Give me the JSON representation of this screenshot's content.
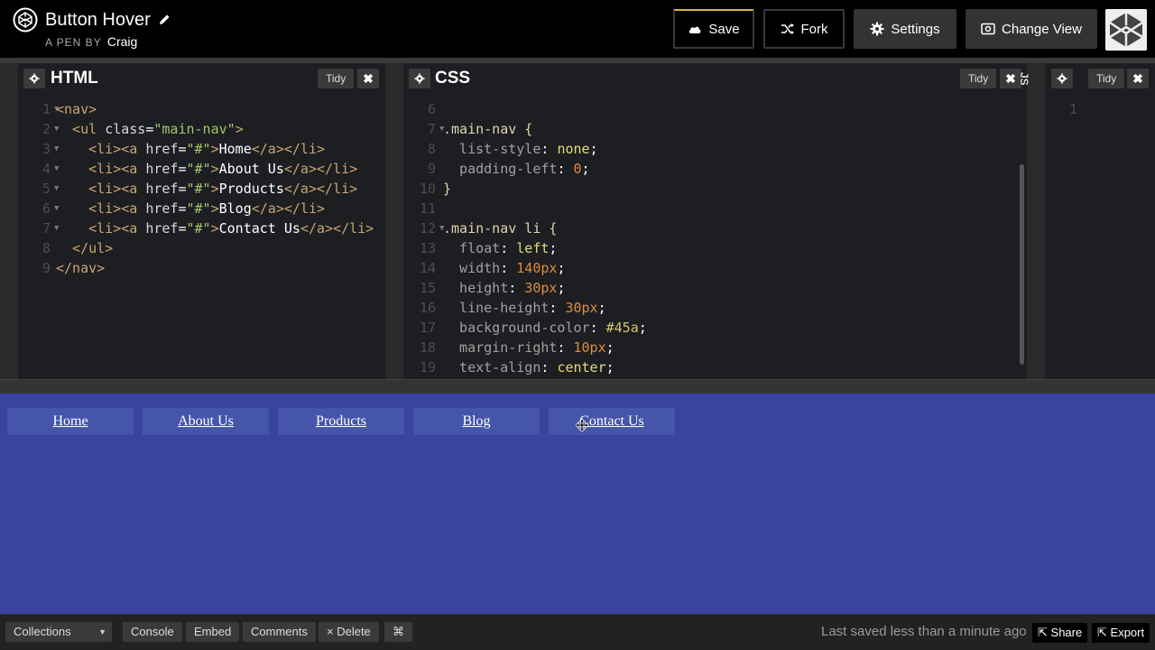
{
  "header": {
    "pen_title": "Button Hover",
    "byline_prefix": "A PEN BY",
    "author": "Craig",
    "buttons": {
      "save": "Save",
      "fork": "Fork",
      "settings": "Settings",
      "change_view": "Change View"
    }
  },
  "editors": {
    "html": {
      "title": "HTML",
      "tidy": "Tidy",
      "close": "✖",
      "lines": [
        {
          "n": "1",
          "fold": true,
          "parts": [
            [
              "<nav>",
              "t-tag"
            ]
          ]
        },
        {
          "n": "2",
          "fold": true,
          "parts": [
            [
              "  <ul ",
              "t-tag"
            ],
            [
              "class",
              "t-attr"
            ],
            [
              "=",
              "t-plain"
            ],
            [
              "\"main-nav\"",
              "t-str"
            ],
            [
              ">",
              "t-tag"
            ]
          ]
        },
        {
          "n": "3",
          "fold": true,
          "parts": [
            [
              "    <li><a ",
              "t-tag"
            ],
            [
              "href",
              "t-attr"
            ],
            [
              "=",
              "t-plain"
            ],
            [
              "\"#\"",
              "t-str"
            ],
            [
              ">",
              "t-tag"
            ],
            [
              "Home",
              "t-plain"
            ],
            [
              "</a></li>",
              "t-tag"
            ]
          ]
        },
        {
          "n": "4",
          "fold": true,
          "parts": [
            [
              "    <li><a ",
              "t-tag"
            ],
            [
              "href",
              "t-attr"
            ],
            [
              "=",
              "t-plain"
            ],
            [
              "\"#\"",
              "t-str"
            ],
            [
              ">",
              "t-tag"
            ],
            [
              "About Us",
              "t-plain"
            ],
            [
              "</a></li>",
              "t-tag"
            ]
          ]
        },
        {
          "n": "5",
          "fold": true,
          "parts": [
            [
              "    <li><a ",
              "t-tag"
            ],
            [
              "href",
              "t-attr"
            ],
            [
              "=",
              "t-plain"
            ],
            [
              "\"#\"",
              "t-str"
            ],
            [
              ">",
              "t-tag"
            ],
            [
              "Products",
              "t-plain"
            ],
            [
              "</a></li>",
              "t-tag"
            ]
          ]
        },
        {
          "n": "6",
          "fold": true,
          "parts": [
            [
              "    <li><a ",
              "t-tag"
            ],
            [
              "href",
              "t-attr"
            ],
            [
              "=",
              "t-plain"
            ],
            [
              "\"#\"",
              "t-str"
            ],
            [
              ">",
              "t-tag"
            ],
            [
              "Blog",
              "t-plain"
            ],
            [
              "</a></li>",
              "t-tag"
            ]
          ]
        },
        {
          "n": "7",
          "fold": true,
          "parts": [
            [
              "    <li><a ",
              "t-tag"
            ],
            [
              "href",
              "t-attr"
            ],
            [
              "=",
              "t-plain"
            ],
            [
              "\"#\"",
              "t-str"
            ],
            [
              ">",
              "t-tag"
            ],
            [
              "Contact Us",
              "t-plain"
            ],
            [
              "</a></li>",
              "t-tag"
            ]
          ]
        },
        {
          "n": "8",
          "fold": false,
          "parts": [
            [
              "  </ul>",
              "t-tag"
            ]
          ]
        },
        {
          "n": "9",
          "fold": false,
          "parts": [
            [
              "</nav>",
              "t-tag"
            ]
          ]
        }
      ]
    },
    "css": {
      "title": "CSS",
      "tidy": "Tidy",
      "close": "✖",
      "lines": [
        {
          "n": "6",
          "fold": false,
          "parts": []
        },
        {
          "n": "7",
          "fold": true,
          "parts": [
            [
              ".main-nav {",
              "t-sel"
            ]
          ]
        },
        {
          "n": "8",
          "fold": false,
          "parts": [
            [
              "  list-style",
              "t-prop"
            ],
            [
              ": ",
              "t-plain"
            ],
            [
              "none",
              "t-val"
            ],
            [
              ";",
              "t-plain"
            ]
          ]
        },
        {
          "n": "9",
          "fold": false,
          "parts": [
            [
              "  padding-left",
              "t-prop"
            ],
            [
              ": ",
              "t-plain"
            ],
            [
              "0",
              "t-num"
            ],
            [
              ";",
              "t-plain"
            ]
          ]
        },
        {
          "n": "10",
          "fold": false,
          "parts": [
            [
              "}",
              "t-sel"
            ]
          ]
        },
        {
          "n": "11",
          "fold": false,
          "parts": []
        },
        {
          "n": "12",
          "fold": true,
          "parts": [
            [
              ".main-nav li {",
              "t-sel"
            ]
          ]
        },
        {
          "n": "13",
          "fold": false,
          "parts": [
            [
              "  float",
              "t-prop"
            ],
            [
              ": ",
              "t-plain"
            ],
            [
              "left",
              "t-val"
            ],
            [
              ";",
              "t-plain"
            ]
          ]
        },
        {
          "n": "14",
          "fold": false,
          "parts": [
            [
              "  width",
              "t-prop"
            ],
            [
              ": ",
              "t-plain"
            ],
            [
              "140px",
              "t-num"
            ],
            [
              ";",
              "t-plain"
            ]
          ]
        },
        {
          "n": "15",
          "fold": false,
          "parts": [
            [
              "  height",
              "t-prop"
            ],
            [
              ": ",
              "t-plain"
            ],
            [
              "30px",
              "t-num"
            ],
            [
              ";",
              "t-plain"
            ]
          ]
        },
        {
          "n": "16",
          "fold": false,
          "parts": [
            [
              "  line-height",
              "t-prop"
            ],
            [
              ": ",
              "t-plain"
            ],
            [
              "30px",
              "t-num"
            ],
            [
              ";",
              "t-plain"
            ]
          ]
        },
        {
          "n": "17",
          "fold": false,
          "parts": [
            [
              "  background-color",
              "t-prop"
            ],
            [
              ": ",
              "t-plain"
            ],
            [
              "#45a",
              "t-col"
            ],
            [
              ";",
              "t-plain"
            ]
          ]
        },
        {
          "n": "18",
          "fold": false,
          "parts": [
            [
              "  margin-right",
              "t-prop"
            ],
            [
              ": ",
              "t-plain"
            ],
            [
              "10px",
              "t-num"
            ],
            [
              ";",
              "t-plain"
            ]
          ]
        },
        {
          "n": "19",
          "fold": false,
          "parts": [
            [
              "  text-align",
              "t-prop"
            ],
            [
              ": ",
              "t-plain"
            ],
            [
              "center",
              "t-val"
            ],
            [
              ";",
              "t-plain"
            ]
          ]
        }
      ]
    },
    "js": {
      "title": "JS",
      "tidy": "Tidy",
      "close": "✖",
      "lines": [
        {
          "n": "1",
          "fold": false,
          "parts": []
        }
      ]
    }
  },
  "preview": {
    "nav_items": [
      "Home",
      "About Us",
      "Products",
      "Blog",
      "Contact Us"
    ]
  },
  "footer": {
    "collections": "Collections",
    "console": "Console",
    "embed": "Embed",
    "comments": "Comments",
    "delete": "× Delete",
    "shortcut": "⌘",
    "last_saved": "Last saved less than a minute ago",
    "share": "Share",
    "export": "Export"
  },
  "colors": {
    "preview_bg": "#3a43a0",
    "nav_item_bg": "#45a",
    "editor_bg": "#1d1e22",
    "save_accent": "#d6b64a"
  }
}
